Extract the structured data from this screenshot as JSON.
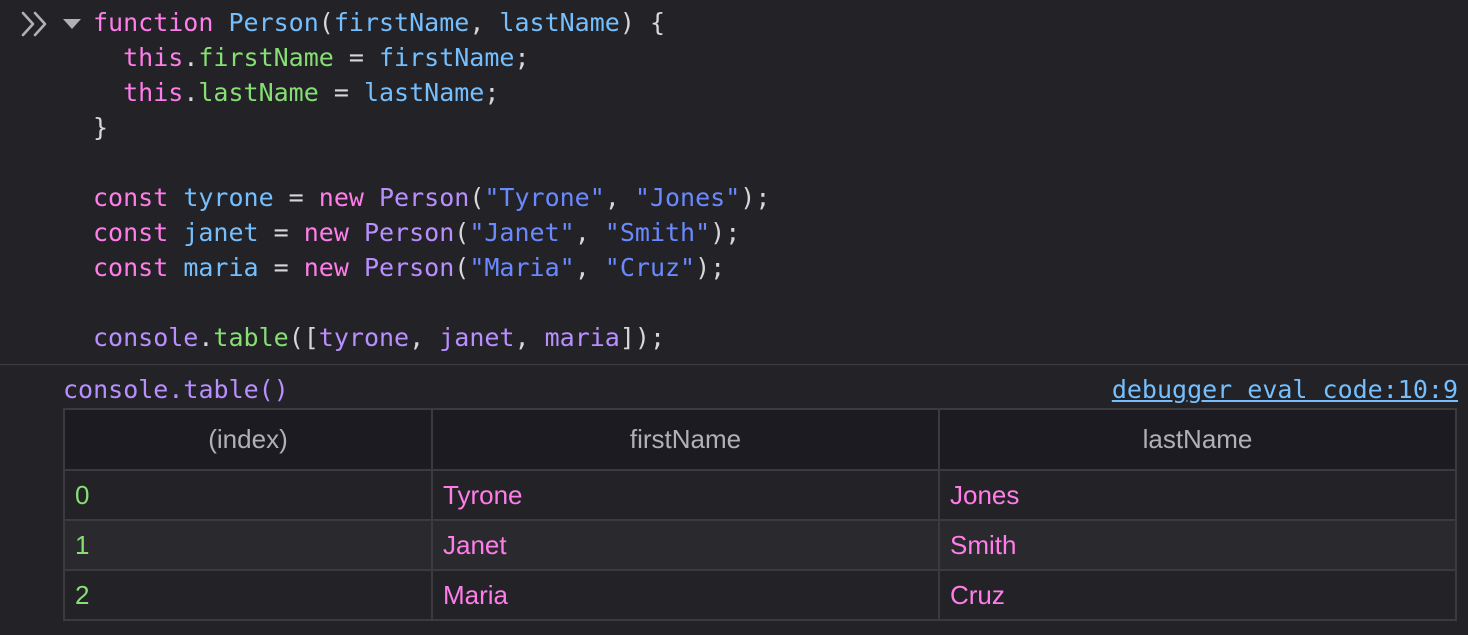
{
  "input": {
    "code_lines": [
      [
        {
          "t": "function ",
          "c": "kw"
        },
        {
          "t": "Person",
          "c": "fn"
        },
        {
          "t": "(",
          "c": "pun"
        },
        {
          "t": "firstName",
          "c": "fn"
        },
        {
          "t": ", ",
          "c": "pun"
        },
        {
          "t": "lastName",
          "c": "fn"
        },
        {
          "t": ") {",
          "c": "pun"
        }
      ],
      [
        {
          "t": "  this",
          "c": "kw"
        },
        {
          "t": ".",
          "c": "pun"
        },
        {
          "t": "firstName",
          "c": "prop"
        },
        {
          "t": " = ",
          "c": "pun"
        },
        {
          "t": "firstName",
          "c": "fn"
        },
        {
          "t": ";",
          "c": "pun"
        }
      ],
      [
        {
          "t": "  this",
          "c": "kw"
        },
        {
          "t": ".",
          "c": "pun"
        },
        {
          "t": "lastName",
          "c": "prop"
        },
        {
          "t": " = ",
          "c": "pun"
        },
        {
          "t": "lastName",
          "c": "fn"
        },
        {
          "t": ";",
          "c": "pun"
        }
      ],
      [
        {
          "t": "}",
          "c": "pun"
        }
      ],
      [],
      [
        {
          "t": "const ",
          "c": "kw"
        },
        {
          "t": "tyrone",
          "c": "fn"
        },
        {
          "t": " = ",
          "c": "pun"
        },
        {
          "t": "new ",
          "c": "kw"
        },
        {
          "t": "Person",
          "c": "ctor"
        },
        {
          "t": "(",
          "c": "pun"
        },
        {
          "t": "\"Tyrone\"",
          "c": "str"
        },
        {
          "t": ", ",
          "c": "pun"
        },
        {
          "t": "\"Jones\"",
          "c": "str"
        },
        {
          "t": ");",
          "c": "pun"
        }
      ],
      [
        {
          "t": "const ",
          "c": "kw"
        },
        {
          "t": "janet",
          "c": "fn"
        },
        {
          "t": " = ",
          "c": "pun"
        },
        {
          "t": "new ",
          "c": "kw"
        },
        {
          "t": "Person",
          "c": "ctor"
        },
        {
          "t": "(",
          "c": "pun"
        },
        {
          "t": "\"Janet\"",
          "c": "str"
        },
        {
          "t": ", ",
          "c": "pun"
        },
        {
          "t": "\"Smith\"",
          "c": "str"
        },
        {
          "t": ");",
          "c": "pun"
        }
      ],
      [
        {
          "t": "const ",
          "c": "kw"
        },
        {
          "t": "maria",
          "c": "fn"
        },
        {
          "t": " = ",
          "c": "pun"
        },
        {
          "t": "new ",
          "c": "kw"
        },
        {
          "t": "Person",
          "c": "ctor"
        },
        {
          "t": "(",
          "c": "pun"
        },
        {
          "t": "\"Maria\"",
          "c": "str"
        },
        {
          "t": ", ",
          "c": "pun"
        },
        {
          "t": "\"Cruz\"",
          "c": "str"
        },
        {
          "t": ");",
          "c": "pun"
        }
      ],
      [],
      [
        {
          "t": "console",
          "c": "ctor"
        },
        {
          "t": ".",
          "c": "pun"
        },
        {
          "t": "table",
          "c": "prop"
        },
        {
          "t": "([",
          "c": "pun"
        },
        {
          "t": "tyrone",
          "c": "ctor"
        },
        {
          "t": ", ",
          "c": "pun"
        },
        {
          "t": "janet",
          "c": "ctor"
        },
        {
          "t": ", ",
          "c": "pun"
        },
        {
          "t": "maria",
          "c": "ctor"
        },
        {
          "t": "]);",
          "c": "pun"
        }
      ]
    ],
    "prompt_icon": "double-chevron-right-icon",
    "collapse_icon": "triangle-down-icon"
  },
  "output": {
    "title": "console.table()",
    "source": "debugger eval code:10:9",
    "table": {
      "columns": [
        "(index)",
        "firstName",
        "lastName"
      ],
      "rows": [
        [
          "0",
          "Tyrone",
          "Jones"
        ],
        [
          "1",
          "Janet",
          "Smith"
        ],
        [
          "2",
          "Maria",
          "Cruz"
        ]
      ]
    }
  },
  "colors": {
    "background": "#232327",
    "keyword": "#ff7de9",
    "identifier": "#75bfff",
    "property": "#86de74",
    "string": "#6b89ff",
    "constructor": "#b98eff"
  }
}
